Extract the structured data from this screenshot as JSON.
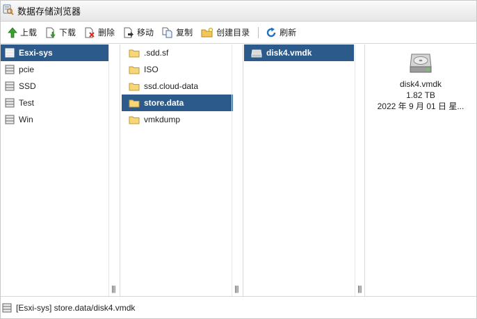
{
  "window": {
    "title": "数据存储浏览器"
  },
  "toolbar": {
    "upload": "上载",
    "download": "下载",
    "delete": "删除",
    "move": "移动",
    "copy": "复制",
    "mkdir": "创建目录",
    "refresh": "刷新"
  },
  "datastores": [
    "Esxi-sys",
    "pcie",
    "SSD",
    "Test",
    "Win"
  ],
  "folders": [
    ".sdd.sf",
    "ISO",
    "ssd.cloud-data",
    "store.data",
    "vmkdump"
  ],
  "files": [
    "disk4.vmdk"
  ],
  "detail": {
    "name": "disk4.vmdk",
    "size": "1.82 TB",
    "date": "2022 年 9 月 01 日 星..."
  },
  "status": {
    "path": "[Esxi-sys] store.data/disk4.vmdk"
  },
  "grip": "|||",
  "colors": {
    "selection": "#2c5a8b"
  }
}
